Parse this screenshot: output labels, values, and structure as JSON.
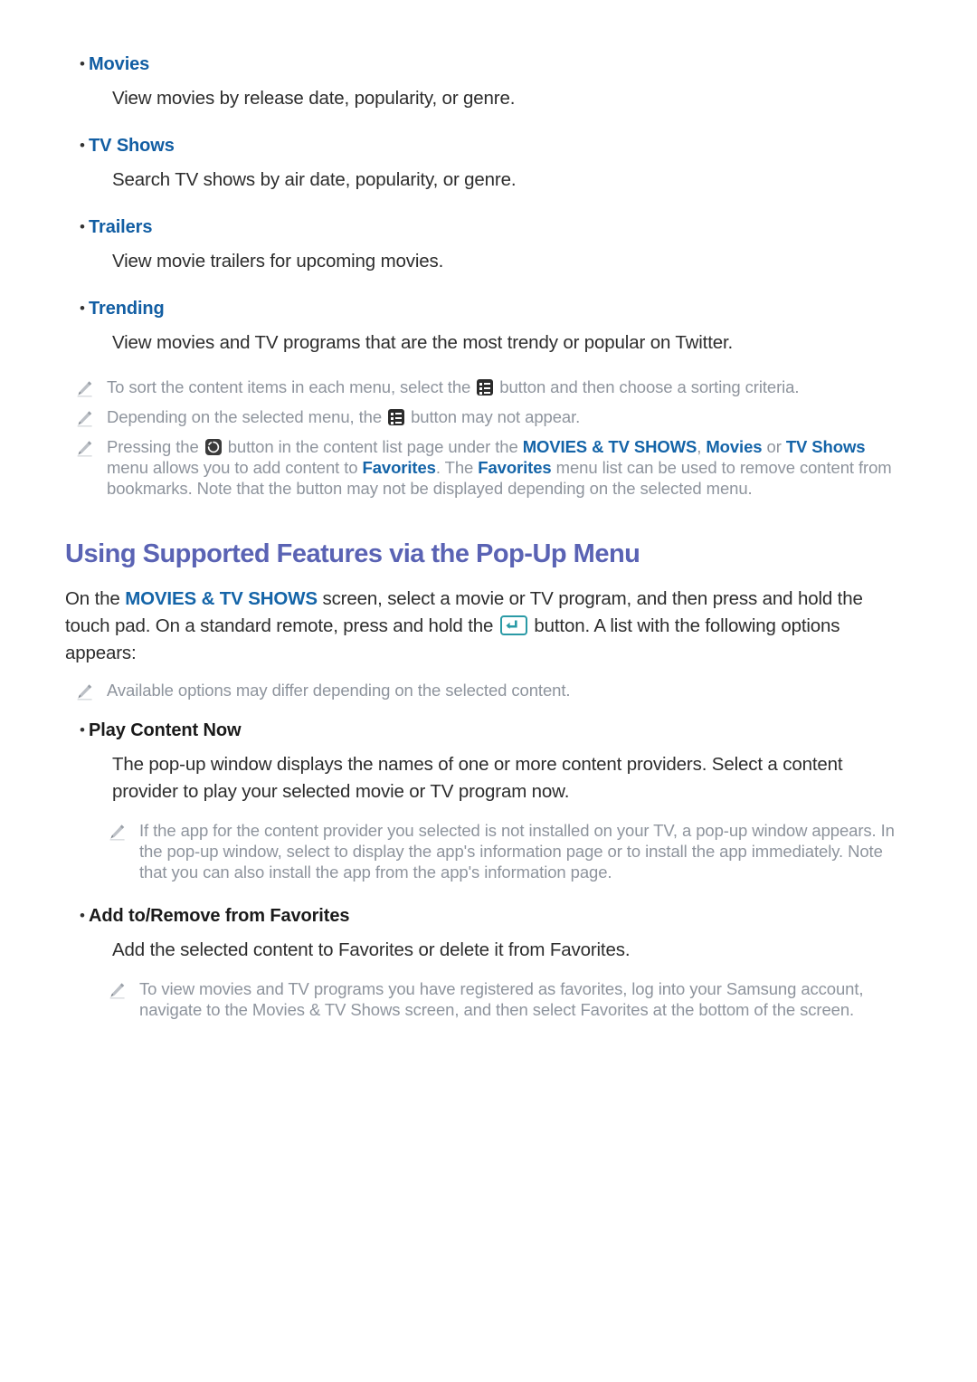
{
  "colors": {
    "link_blue": "#125ea3",
    "heading_purple": "#5a63b4",
    "note_grey": "#8e949d",
    "body_black": "#2d2d2d",
    "icon_teal": "#2a9aa6"
  },
  "icons": {
    "note": "pencil-icon",
    "sort_button": "list-menu-icon",
    "favorites_button": "circular-arrow-icon",
    "enter_button": "enter-return-icon"
  },
  "menu_items": [
    {
      "bullet": "•",
      "label": "Movies",
      "style": "blue",
      "description": "View movies by release date, popularity, or genre."
    },
    {
      "bullet": "•",
      "label": "TV Shows",
      "style": "blue",
      "description": "Search TV shows by air date, popularity, or genre."
    },
    {
      "bullet": "•",
      "label": "Trailers",
      "style": "blue",
      "description": "View movie trailers for upcoming movies."
    },
    {
      "bullet": "•",
      "label": "Trending",
      "style": "blue",
      "description": "View movies and TV programs that are the most trendy or popular on Twitter."
    }
  ],
  "notes_group_1": [
    {
      "before_icon": "To sort the content items in each menu, select the ",
      "icon": "list-menu-icon",
      "after_icon": " button and then choose a sorting criteria."
    },
    {
      "before_icon": "Depending on the selected menu, the ",
      "icon": "list-menu-icon",
      "after_icon": " button may not appear."
    }
  ],
  "note_favorites": {
    "part_1": "Pressing the ",
    "icon": "circular-arrow-icon",
    "part_2": " button in the content list page under the ",
    "link_1": "MOVIES & TV SHOWS",
    "part_3": ", ",
    "link_2": "Movies",
    "part_4": " or ",
    "link_3": "TV Shows",
    "part_5": " menu allows you to add content to ",
    "link_4": "Favorites",
    "part_6": ". The ",
    "link_5": "Favorites",
    "part_7": " menu list can be used to remove content from bookmarks. Note that the button may not be displayed depending on the selected menu."
  },
  "section": {
    "heading": "Using Supported Features via the Pop-Up Menu",
    "intro": {
      "part_1": "On the ",
      "link_1": "MOVIES & TV SHOWS",
      "part_2": " screen, select a movie or TV program, and then press and hold the touch pad. On a standard remote, press and hold the ",
      "icon": "enter-return-icon",
      "part_3": " button. A list with the following options appears:"
    },
    "note_available": "Available options may differ depending on the selected content."
  },
  "options": [
    {
      "bullet": "•",
      "label": "Play Content Now",
      "style": "black",
      "description": "The pop-up window displays the names of one or more content providers. Select a content provider to play your selected movie or TV program now.",
      "note": "If the app for the content provider you selected is not installed on your TV, a pop-up window appears. In the pop-up window, select to display the app's information page or to install the app immediately. Note that you can also install the app from the app's information page."
    },
    {
      "bullet": "•",
      "label": "Add to/Remove from Favorites",
      "style": "black",
      "description": "Add the selected content to Favorites or delete it from Favorites.",
      "note": "To view movies and TV programs you have registered as favorites, log into your Samsung account, navigate to the Movies & TV Shows screen, and then select Favorites at the bottom of the screen."
    }
  ]
}
